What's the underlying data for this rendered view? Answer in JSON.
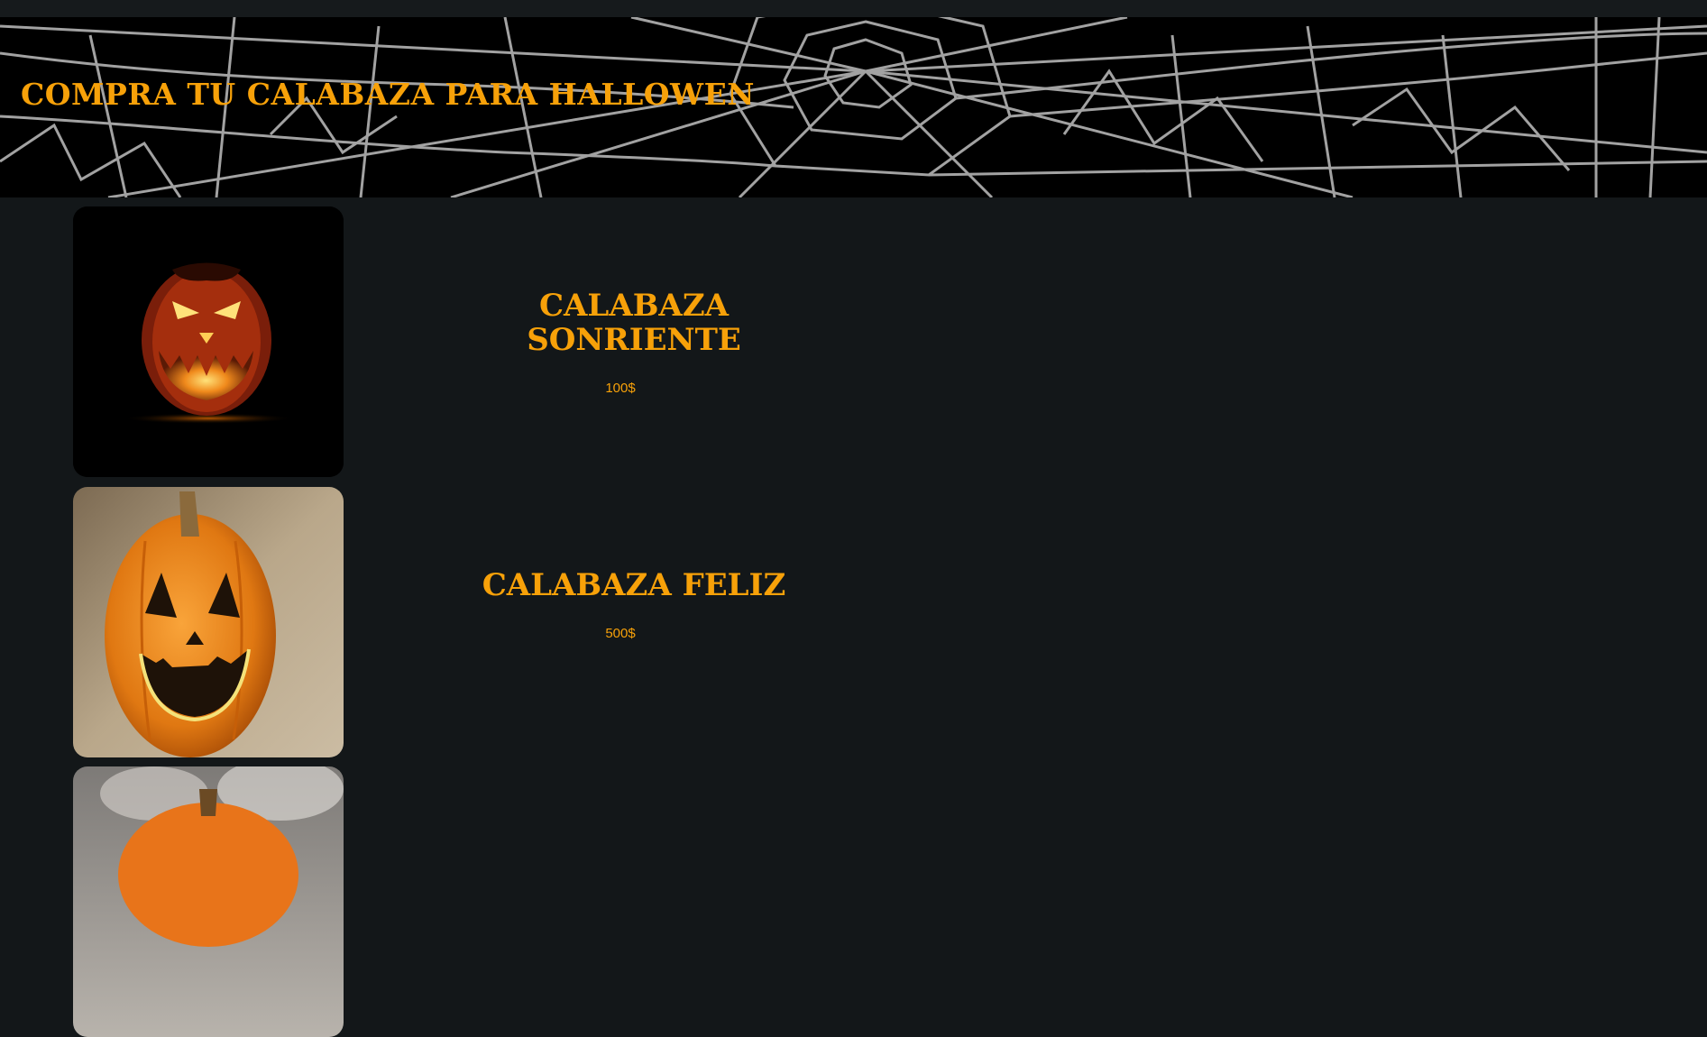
{
  "header": {
    "title": "COMPRA TU CALABAZA PARA HALLOWEN",
    "background": "spiderweb-image"
  },
  "products": [
    {
      "name": "CALABAZA\nSONRIENTE",
      "price": "100$",
      "image": "jack-o-lantern-lit-image"
    },
    {
      "name": "CALABAZA FELIZ",
      "price": "500$",
      "image": "happy-pumpkin-image"
    },
    {
      "name": "",
      "price": "",
      "image": "smoking-pumpkin-image"
    }
  ],
  "colors": {
    "accent": "#f7a109",
    "background": "#131719",
    "banner": "#000000"
  }
}
